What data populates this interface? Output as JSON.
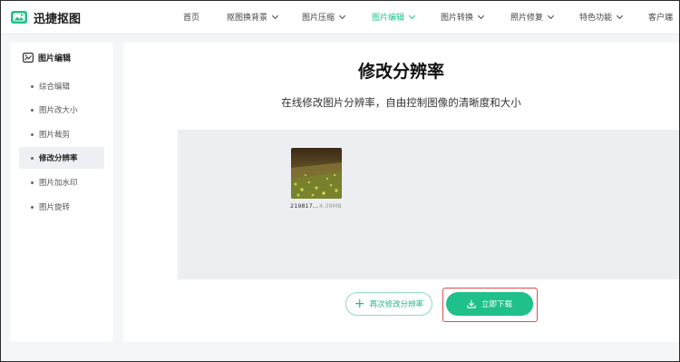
{
  "brand": {
    "name": "迅捷抠图",
    "accent": "#21c38f"
  },
  "nav": {
    "items": [
      {
        "label": "首页",
        "dropdown": false
      },
      {
        "label": "抠图换背景",
        "dropdown": true
      },
      {
        "label": "图片压缩",
        "dropdown": true
      },
      {
        "label": "图片编辑",
        "dropdown": true,
        "active": true
      },
      {
        "label": "图片转换",
        "dropdown": true
      },
      {
        "label": "照片修复",
        "dropdown": true
      },
      {
        "label": "特色功能",
        "dropdown": true
      },
      {
        "label": "客户端",
        "dropdown": false
      }
    ]
  },
  "sidebar": {
    "title": "图片编辑",
    "items": [
      {
        "label": "综合编辑"
      },
      {
        "label": "图片改大小"
      },
      {
        "label": "图片裁剪"
      },
      {
        "label": "修改分辨率",
        "active": true
      },
      {
        "label": "图片加水印"
      },
      {
        "label": "图片旋转"
      }
    ]
  },
  "main": {
    "title": "修改分辨率",
    "subtitle": "在线修改图片分辨率，自由控制图像的清晰度和大小",
    "file": {
      "name": "219817...",
      "size": "4.39MB"
    },
    "again_button": "再次修改分辨率",
    "download_button": "立即下载"
  }
}
